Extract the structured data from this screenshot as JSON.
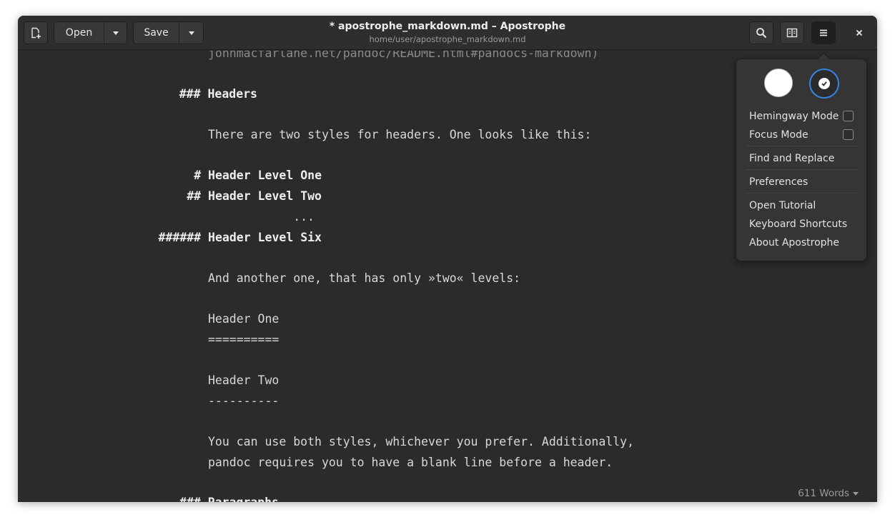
{
  "window": {
    "title": "* apostrophe_markdown.md – Apostrophe",
    "subtitle": "home/user/apostrophe_markdown.md"
  },
  "toolbar": {
    "open_label": "Open",
    "save_label": "Save"
  },
  "icons": {
    "new": "new-document-icon",
    "dropdown": "chevron-down-icon",
    "search": "search-icon",
    "preview": "book-preview-icon",
    "menu": "hamburger-menu-icon",
    "close": "close-icon"
  },
  "editor": {
    "lines": [
      "johnmacfarlane.net/pandoc/README.html#pandocs-markdown)",
      "### Headers",
      "There are two styles for headers. One looks like this:",
      "# Header Level One",
      "## Header Level Two",
      "...",
      "###### Header Level Six",
      "And another one, that has only »two« levels:",
      "Header One",
      "==========",
      "Header Two",
      "----------",
      "You can use both styles, whichever you prefer. Additionally,",
      "pandoc requires you to have a blank line before a header.",
      "### Paragraphs"
    ]
  },
  "status": {
    "word_count": "611 Words"
  },
  "menu": {
    "hemingway_label": "Hemingway Mode",
    "hemingway_checked": false,
    "focus_label": "Focus Mode",
    "focus_checked": false,
    "find_replace_label": "Find and Replace",
    "preferences_label": "Preferences",
    "tutorial_label": "Open Tutorial",
    "shortcuts_label": "Keyboard Shortcuts",
    "about_label": "About Apostrophe",
    "selected_theme": "dark"
  },
  "colors": {
    "accent": "#3584e4",
    "background": "#2b2b2b"
  }
}
